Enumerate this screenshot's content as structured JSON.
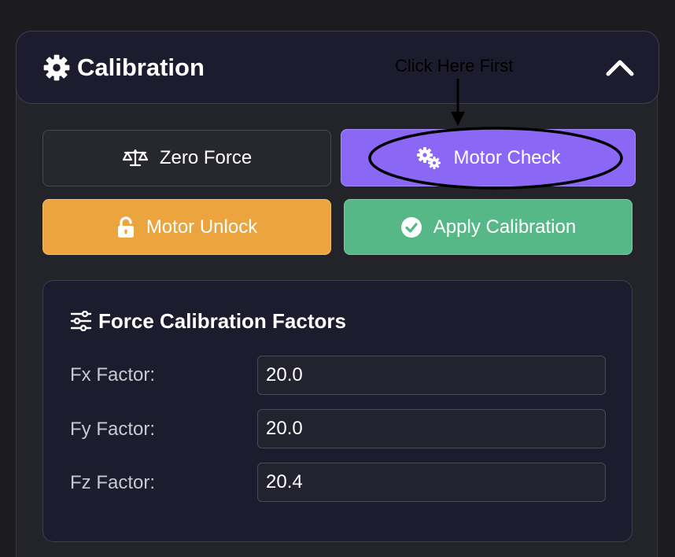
{
  "panel": {
    "title": "Calibration",
    "icon": "gear-icon",
    "collapse_icon": "chevron-up-icon"
  },
  "annotation": {
    "text": "Click Here First"
  },
  "buttons": {
    "zero_force": {
      "label": "Zero Force",
      "icon": "balance-scale-icon"
    },
    "motor_check": {
      "label": "Motor Check",
      "icon": "gears-icon",
      "color": "#8b67f5"
    },
    "motor_unlock": {
      "label": "Motor Unlock",
      "icon": "unlock-icon",
      "color": "#eba43e"
    },
    "apply_calibration": {
      "label": "Apply Calibration",
      "icon": "check-circle-icon",
      "color": "#56b886"
    }
  },
  "factors": {
    "title": "Force Calibration Factors",
    "icon": "sliders-icon",
    "rows": [
      {
        "label": "Fx Factor:",
        "value": "20.0"
      },
      {
        "label": "Fy Factor:",
        "value": "20.0"
      },
      {
        "label": "Fz Factor:",
        "value": "20.4"
      }
    ]
  }
}
